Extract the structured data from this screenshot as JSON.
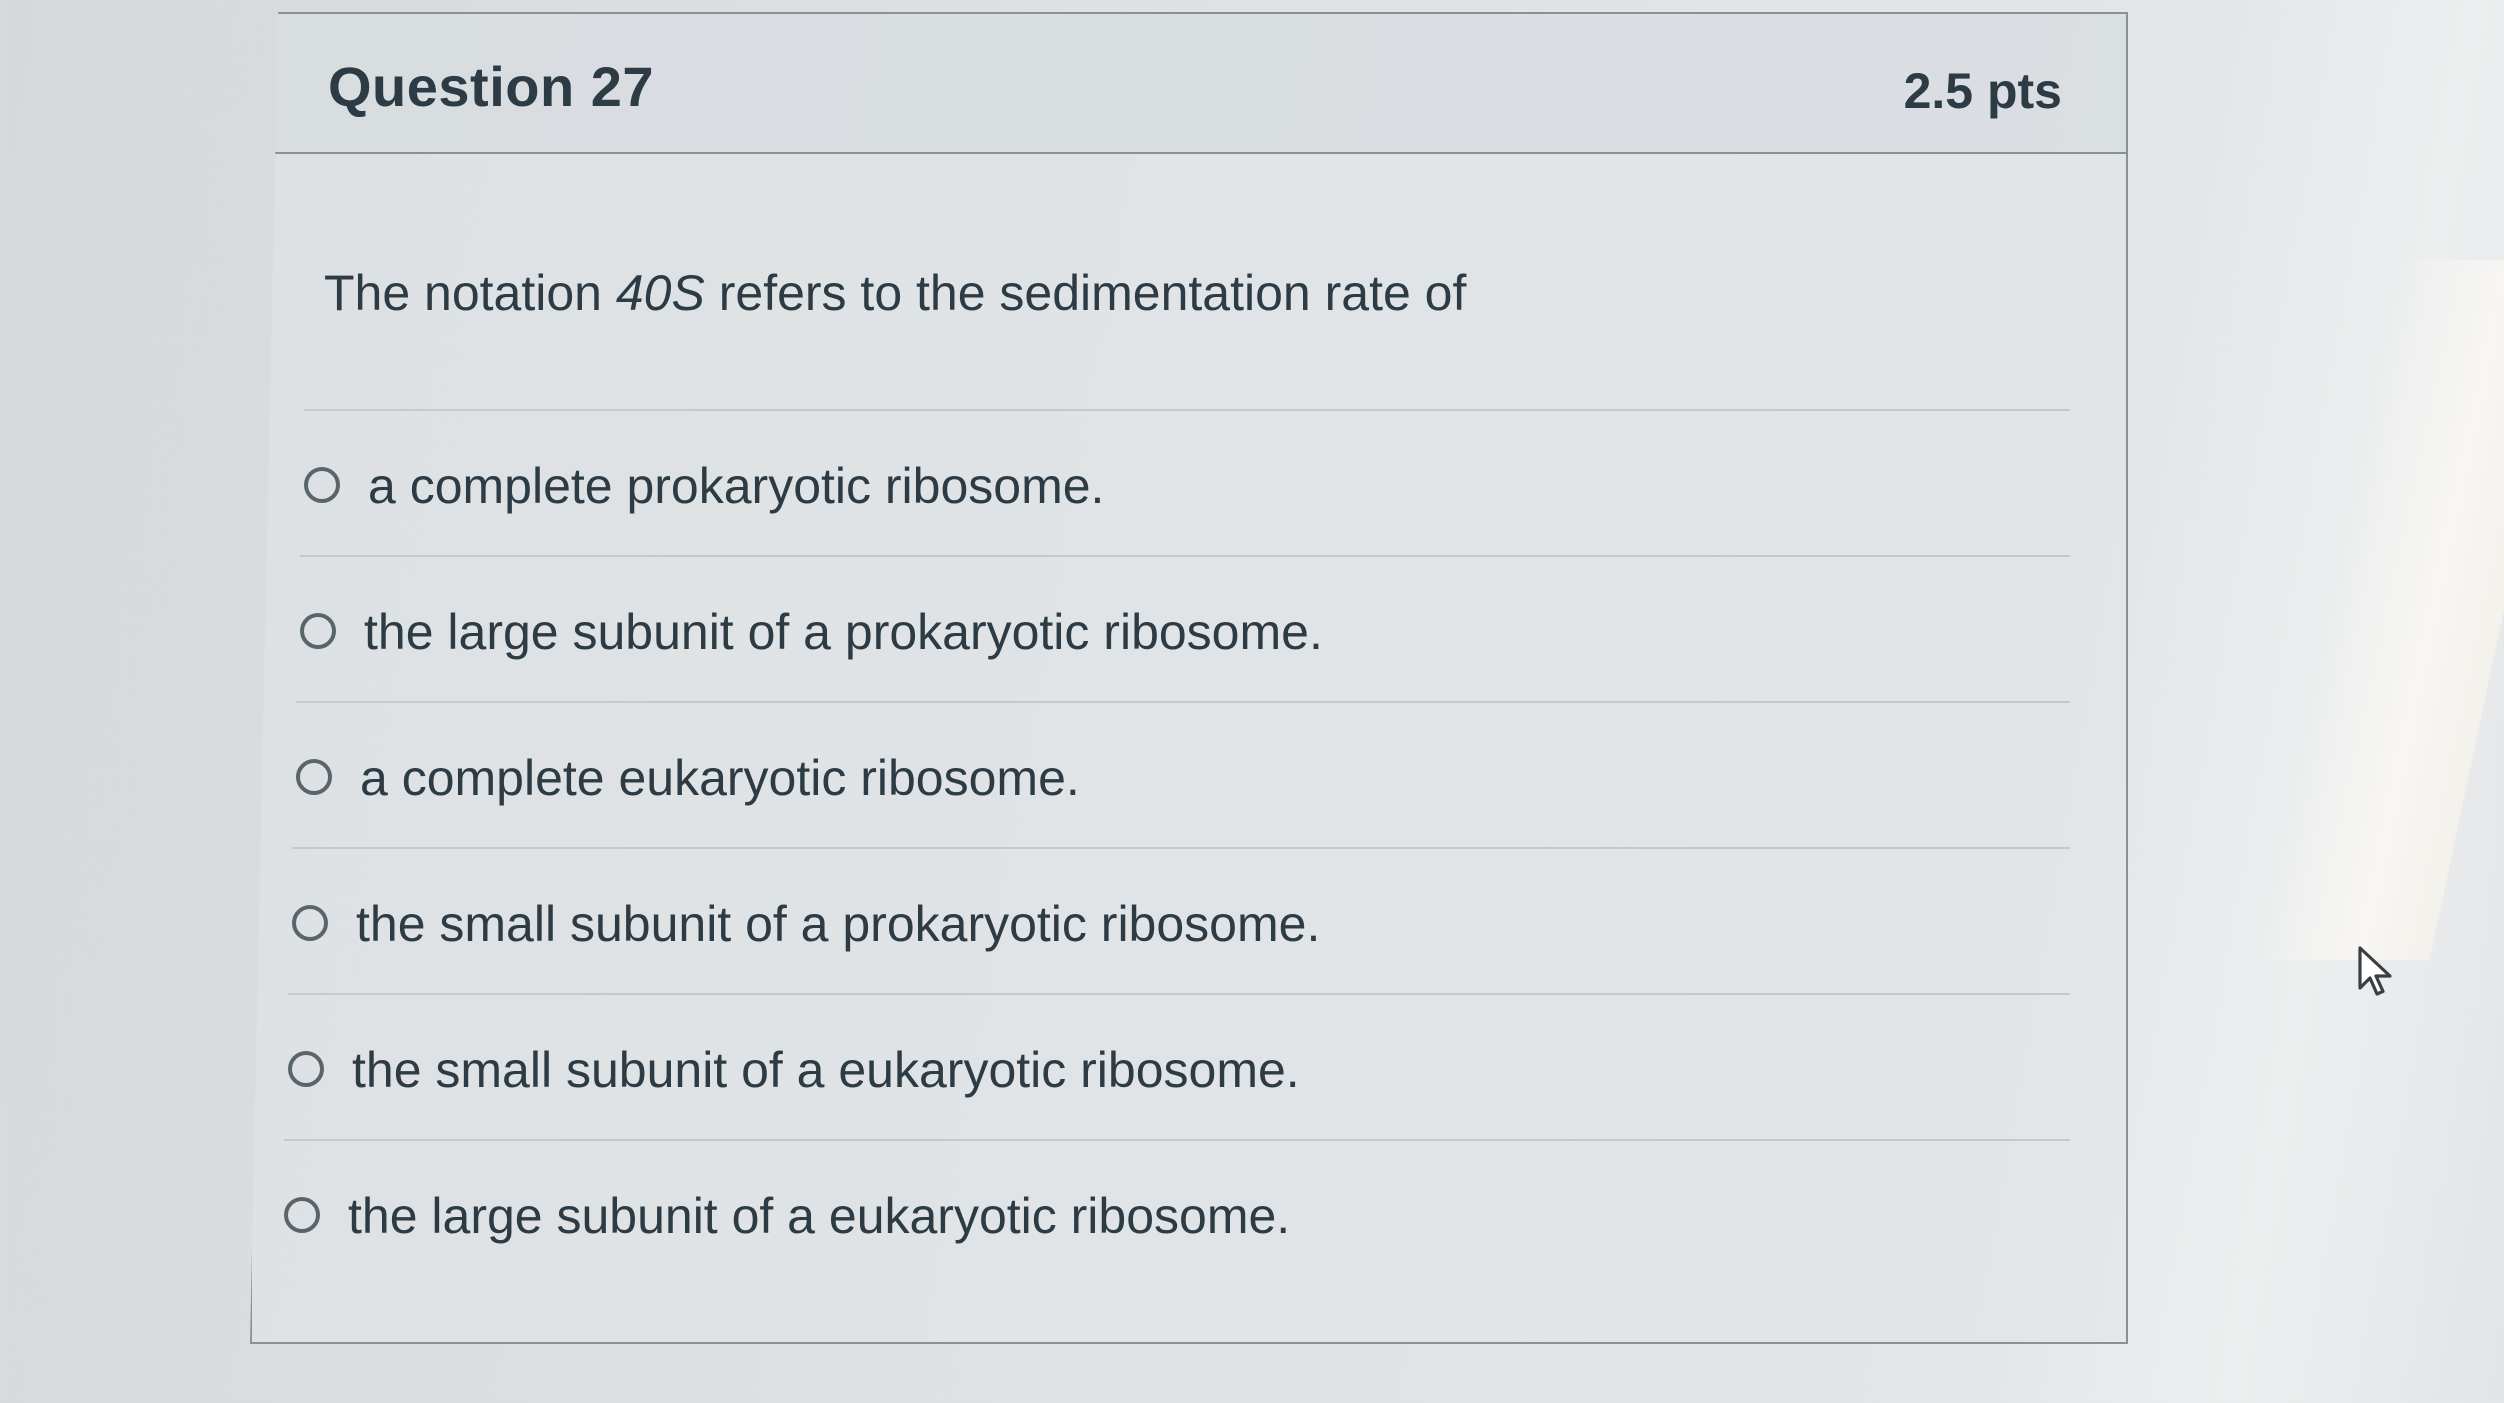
{
  "question": {
    "title": "Question 27",
    "points": "2.5 pts",
    "text_before": "The notation ",
    "notation": "40S",
    "text_after": " refers to the sedimentation rate of"
  },
  "answers": [
    {
      "label": "a complete prokaryotic ribosome."
    },
    {
      "label": "the large subunit of a prokaryotic ribosome."
    },
    {
      "label": "a complete eukaryotic ribosome."
    },
    {
      "label": "the small subunit of a prokaryotic ribosome."
    },
    {
      "label": "the small subunit of a eukaryotic ribosome."
    },
    {
      "label": "the large subunit of a eukaryotic ribosome."
    }
  ],
  "selected_answer": null,
  "icons": {
    "cursor": "mouse-pointer-icon",
    "radio": "radio-unchecked-icon"
  },
  "colors": {
    "text": "#2d3b45",
    "border": "#8a9196",
    "divider": "#c4c9cc"
  }
}
